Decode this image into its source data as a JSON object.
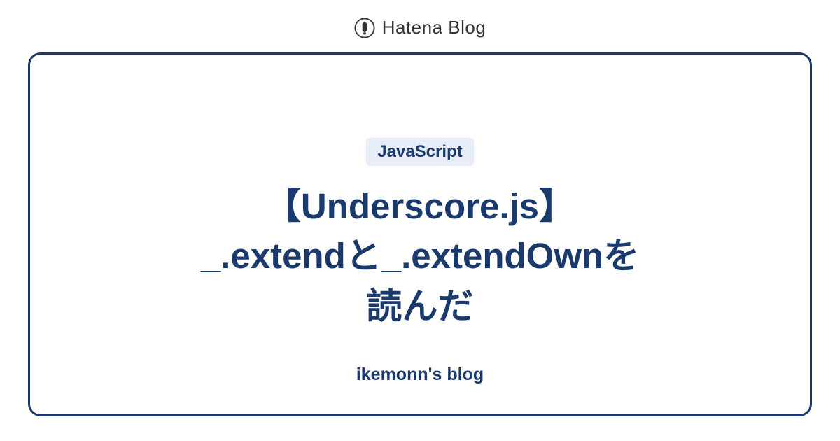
{
  "header": {
    "logo_text": "Hatena Blog"
  },
  "card": {
    "tag": "JavaScript",
    "title": "【Underscore.js】\n_.extendと_.extendOwnを\n読んだ",
    "blog_name": "ikemonn's blog"
  }
}
